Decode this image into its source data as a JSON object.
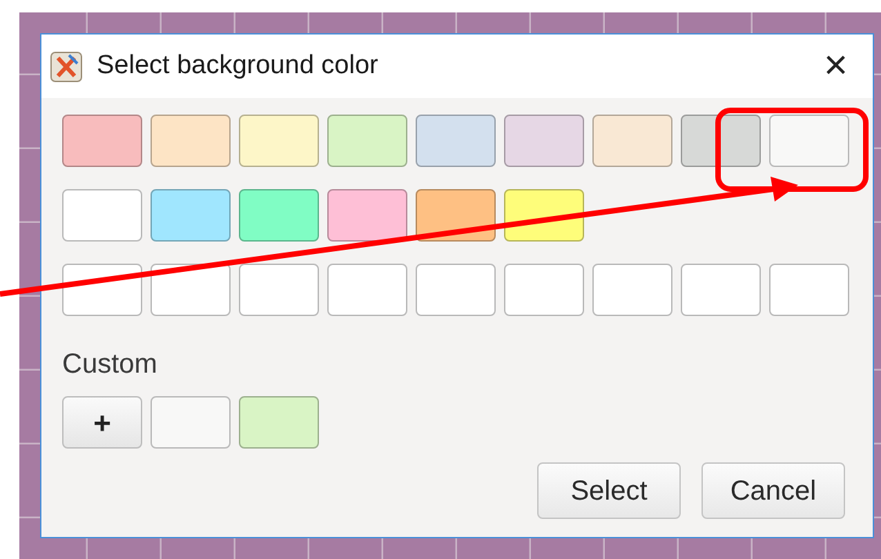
{
  "window": {
    "title": "Select background color",
    "close_label": "×"
  },
  "swatch_rows": [
    {
      "swatches": [
        {
          "color": "#f8bcbd"
        },
        {
          "color": "#fde4c5"
        },
        {
          "color": "#fdf6c8"
        },
        {
          "color": "#d9f4c5"
        },
        {
          "color": "#d3e0ee"
        },
        {
          "color": "#e6d7e5"
        },
        {
          "color": "#f9e8d4"
        },
        {
          "color": "#d7d9d7"
        },
        {
          "color": "#f8f8f7"
        }
      ]
    },
    {
      "swatches": [
        {
          "color": "#ffffff"
        },
        {
          "color": "#a0e6fe"
        },
        {
          "color": "#80fdc4"
        },
        {
          "color": "#febfd6"
        },
        {
          "color": "#fec083"
        },
        {
          "color": "#fefd7a"
        }
      ]
    },
    {
      "swatches": [
        {
          "color": "#ffffff"
        },
        {
          "color": "#ffffff"
        },
        {
          "color": "#ffffff"
        },
        {
          "color": "#ffffff"
        },
        {
          "color": "#ffffff"
        },
        {
          "color": "#ffffff"
        },
        {
          "color": "#ffffff"
        },
        {
          "color": "#ffffff"
        },
        {
          "color": "#ffffff"
        }
      ]
    }
  ],
  "custom": {
    "label": "Custom",
    "add_button": "+",
    "swatches": [
      {
        "color": "#f8f8f7"
      },
      {
        "color": "#d9f4c5"
      }
    ]
  },
  "buttons": [
    "Select",
    "Cancel"
  ]
}
